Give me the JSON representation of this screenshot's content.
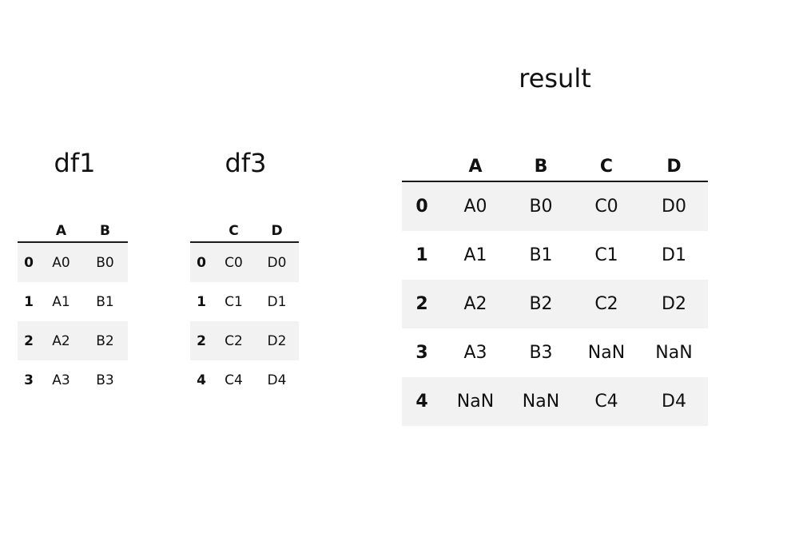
{
  "page": {
    "background_color": "#ffffff",
    "text_color": "#111111",
    "stripe_color": "#f2f2f2",
    "rule_color": "#1a1a1a"
  },
  "panels": {
    "df1": {
      "title": "df1",
      "index_header": "",
      "columns": [
        "A",
        "B"
      ],
      "index": [
        "0",
        "1",
        "2",
        "3"
      ],
      "rows": [
        [
          "A0",
          "B0"
        ],
        [
          "A1",
          "B1"
        ],
        [
          "A2",
          "B2"
        ],
        [
          "A3",
          "B3"
        ]
      ]
    },
    "df3": {
      "title": "df3",
      "index_header": "",
      "columns": [
        "C",
        "D"
      ],
      "index": [
        "0",
        "1",
        "2",
        "4"
      ],
      "rows": [
        [
          "C0",
          "D0"
        ],
        [
          "C1",
          "D1"
        ],
        [
          "C2",
          "D2"
        ],
        [
          "C4",
          "D4"
        ]
      ]
    },
    "result": {
      "title": "result",
      "index_header": "",
      "columns": [
        "A",
        "B",
        "C",
        "D"
      ],
      "index": [
        "0",
        "1",
        "2",
        "3",
        "4"
      ],
      "rows": [
        [
          "A0",
          "B0",
          "C0",
          "D0"
        ],
        [
          "A1",
          "B1",
          "C1",
          "D1"
        ],
        [
          "A2",
          "B2",
          "C2",
          "D2"
        ],
        [
          "A3",
          "B3",
          "NaN",
          "NaN"
        ],
        [
          "NaN",
          "NaN",
          "C4",
          "D4"
        ]
      ]
    }
  }
}
